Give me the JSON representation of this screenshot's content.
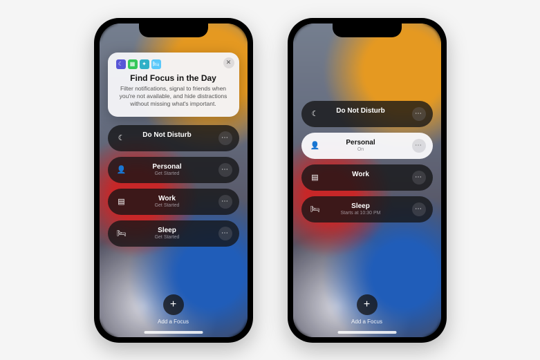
{
  "info_card": {
    "title": "Find Focus in the Day",
    "desc": "Filter notifications, signal to friends when you're not available, and hide distractions without missing what's important."
  },
  "phone1": {
    "items": [
      {
        "icon": "☾",
        "title": "Do Not Disturb",
        "sub": ""
      },
      {
        "icon": "👤",
        "title": "Personal",
        "sub": "Get Started"
      },
      {
        "icon": "▤",
        "title": "Work",
        "sub": "Get Started"
      },
      {
        "icon": "🛏",
        "title": "Sleep",
        "sub": "Get Started"
      }
    ]
  },
  "phone2": {
    "items": [
      {
        "icon": "☾",
        "title": "Do Not Disturb",
        "sub": ""
      },
      {
        "icon": "👤",
        "title": "Personal",
        "sub": "On"
      },
      {
        "icon": "▤",
        "title": "Work",
        "sub": ""
      },
      {
        "icon": "🛏",
        "title": "Sleep",
        "sub": "Starts at 10:30 PM"
      }
    ]
  },
  "add_label": "Add a Focus"
}
